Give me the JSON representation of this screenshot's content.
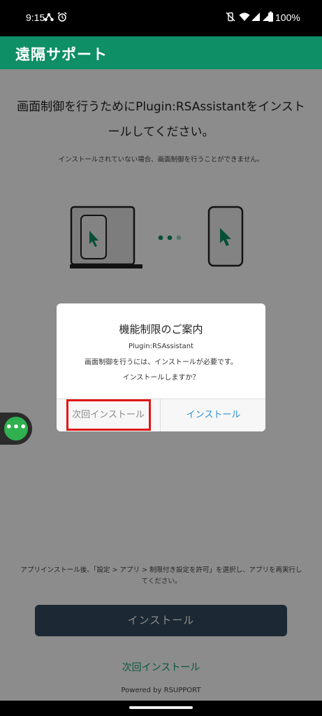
{
  "status_bar": {
    "time": "9:15",
    "battery": "100%"
  },
  "app_bar": {
    "title": "遠隔サポート"
  },
  "content": {
    "headline": "画面制御を行うためにPlugin:RSAssistantをインストールしてください。",
    "note": "インストールされていない場合、画面制御を行うことができません。",
    "bottom_note": "アプリインストール後、「設定 > アプリ > 制限付き設定を許可」を選択し、アプリを再実行してください。",
    "install_button": "インストール",
    "next_time_link": "次回インストール",
    "powered_by": "Powered by RSUPPORT"
  },
  "float_menu": {
    "icon": "more-dots-icon",
    "glyph": "•••"
  },
  "dialog": {
    "title": "機能制限のご案内",
    "plugin_name": "Plugin:RSAssistant",
    "message_line1": "画面制御を行うには、インストールが必要です。",
    "message_line2": "インストールしますか？",
    "later_button": "次回インストール",
    "install_button": "インストール"
  },
  "colors": {
    "app_bar": "#0e8f66",
    "install_button": "#33495e",
    "link": "#14a06f",
    "dialog_install": "#2d8fd6",
    "highlight": "#e21616",
    "float_button": "#2fb14f"
  }
}
